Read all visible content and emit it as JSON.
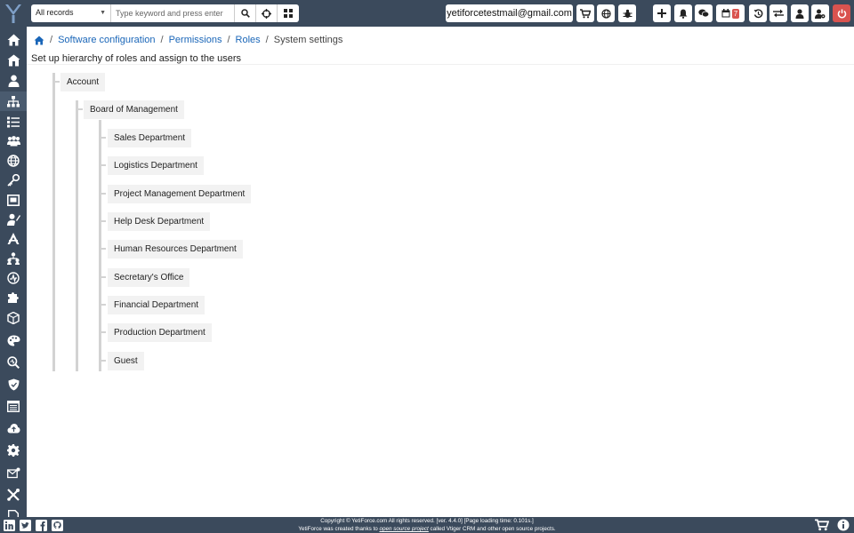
{
  "topbar": {
    "search_select_value": "All records",
    "search_placeholder": "Type keyword and press enter",
    "user_email": "yetiforcetestmail@gmail.com",
    "calendar_badge": "7"
  },
  "breadcrumb": {
    "items": [
      "Software configuration",
      "Permissions",
      "Roles"
    ],
    "current": "System settings"
  },
  "page": {
    "subtitle": "Set up hierarchy of roles and assign to the users"
  },
  "tree": {
    "root": "Account",
    "level1": "Board of Management",
    "level2": [
      "Sales Department",
      "Logistics Department",
      "Project Management Department",
      "Help Desk Department",
      "Human Resources Department",
      "Secretary's Office",
      "Financial Department",
      "Production Department",
      "Guest"
    ]
  },
  "footer": {
    "line1": "Copyright © YetiForce.com All rights reserved. [ver. 4.4.0] [Page loading time: 0.101s.]",
    "line2_a": "YetiForce was created thanks to ",
    "line2_link": "open source project",
    "line2_b": " called Vtiger CRM and other open source projects."
  },
  "colors": {
    "navbar": "#3b4a5c",
    "link": "#1a66b8",
    "danger": "#d9534f",
    "node_bg": "#f2f2f2",
    "tree_line": "#d3d3d3"
  }
}
